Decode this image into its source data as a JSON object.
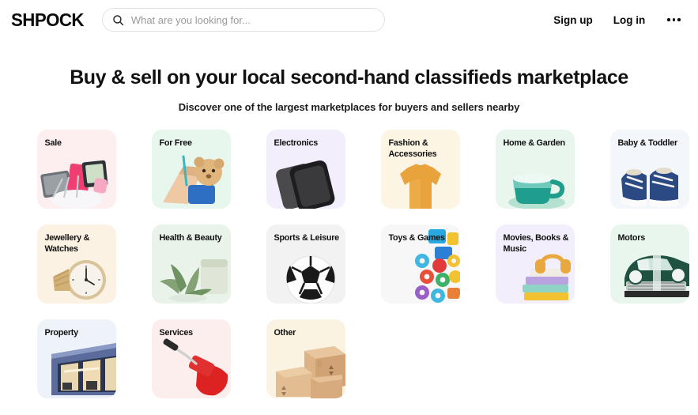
{
  "header": {
    "logo": "SHPOCK",
    "search": {
      "placeholder": "What are you looking for...",
      "value": "",
      "icon": "search-icon"
    },
    "signup_label": "Sign up",
    "login_label": "Log in",
    "more_icon": "more-horizontal-icon"
  },
  "hero": {
    "title": "Buy & sell on your local second-hand classifieds marketplace",
    "subtitle": "Discover one of the largest marketplaces for buyers and sellers nearby"
  },
  "categories": [
    {
      "label": "Sale",
      "bg": "#fdeef0",
      "art": "sale"
    },
    {
      "label": "For Free",
      "bg": "#e8f7ee",
      "art": "for-free"
    },
    {
      "label": "Electronics",
      "bg": "#f3eefb",
      "art": "electronics"
    },
    {
      "label": "Fashion & Accessories",
      "bg": "#fdf5e4",
      "art": "fashion"
    },
    {
      "label": "Home & Garden",
      "bg": "#e9f6ee",
      "art": "home-garden"
    },
    {
      "label": "Baby & Toddler",
      "bg": "#f3f6fb",
      "art": "baby-toddler"
    },
    {
      "label": "Jewellery & Watches",
      "bg": "#fbf2e4",
      "art": "jewellery"
    },
    {
      "label": "Health & Beauty",
      "bg": "#e9f3ea",
      "art": "health-beauty"
    },
    {
      "label": "Sports & Leisure",
      "bg": "#f2f2f2",
      "art": "sports"
    },
    {
      "label": "Toys & Games",
      "bg": "#f7f7f7",
      "art": "toys"
    },
    {
      "label": "Movies, Books & Music",
      "bg": "#f3eefb",
      "art": "movies-books"
    },
    {
      "label": "Motors",
      "bg": "#e9f6ee",
      "art": "motors"
    },
    {
      "label": "Property",
      "bg": "#eef3fa",
      "art": "property"
    },
    {
      "label": "Services",
      "bg": "#fdeeee",
      "art": "services"
    },
    {
      "label": "Other",
      "bg": "#fbf3e2",
      "art": "other"
    }
  ]
}
